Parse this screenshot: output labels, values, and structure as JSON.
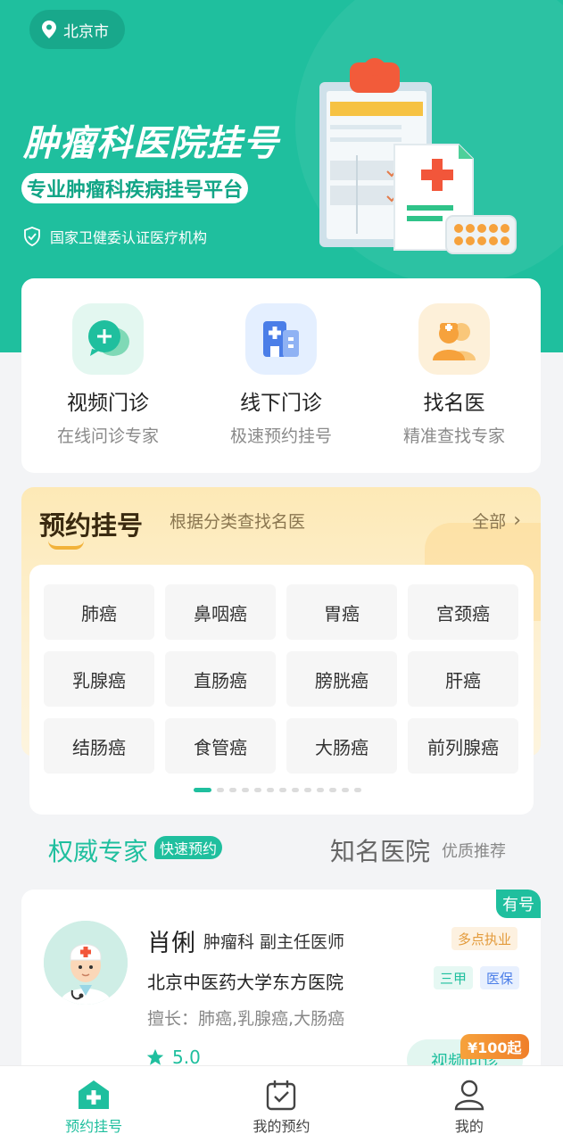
{
  "location": {
    "city": "北京市"
  },
  "hero": {
    "title": "肿瘤科医院挂号",
    "subtitle": "专业肿瘤科疾病挂号平台",
    "cert": "国家卫健委认证医疗机构"
  },
  "quick_actions": [
    {
      "label": "视频门诊",
      "sub": "在线问诊专家",
      "icon": "video-chat-icon"
    },
    {
      "label": "线下门诊",
      "sub": "极速预约挂号",
      "icon": "hospital-building-icon"
    },
    {
      "label": "找名医",
      "sub": "精准查找专家",
      "icon": "doctors-icon"
    }
  ],
  "booking": {
    "title": "预约挂号",
    "subtitle": "根据分类查找名医",
    "all_label": "全部",
    "categories": [
      "肺癌",
      "鼻咽癌",
      "胃癌",
      "宫颈癌",
      "乳腺癌",
      "直肠癌",
      "膀胱癌",
      "肝癌",
      "结肠癌",
      "食管癌",
      "大肠癌",
      "前列腺癌"
    ],
    "page_count": 13,
    "active_page": 1
  },
  "section_tabs": {
    "experts": "权威专家",
    "experts_badge": "快速预约",
    "hospitals": "知名医院",
    "hospitals_sub": "优质推荐"
  },
  "doctor": {
    "availability": "有号",
    "name": "肖俐",
    "dept_title": "肿瘤科 副主任医师",
    "hospital": "北京中医药大学东方医院",
    "skill": "擅长：肺癌,乳腺癌,大肠癌",
    "rating": "5.0",
    "tags": {
      "practice": "多点执业",
      "grade": "三甲",
      "insurance": "医保"
    },
    "price": "¥100起",
    "consult_label": "视频问诊"
  },
  "bottom_nav": [
    {
      "label": "预约挂号",
      "icon": "hospital-plus-icon",
      "active": true
    },
    {
      "label": "我的预约",
      "icon": "calendar-check-icon",
      "active": false
    },
    {
      "label": "我的",
      "icon": "user-icon",
      "active": false
    }
  ],
  "colors": {
    "primary": "#1fbf9e",
    "accent_orange": "#f07f2a"
  }
}
